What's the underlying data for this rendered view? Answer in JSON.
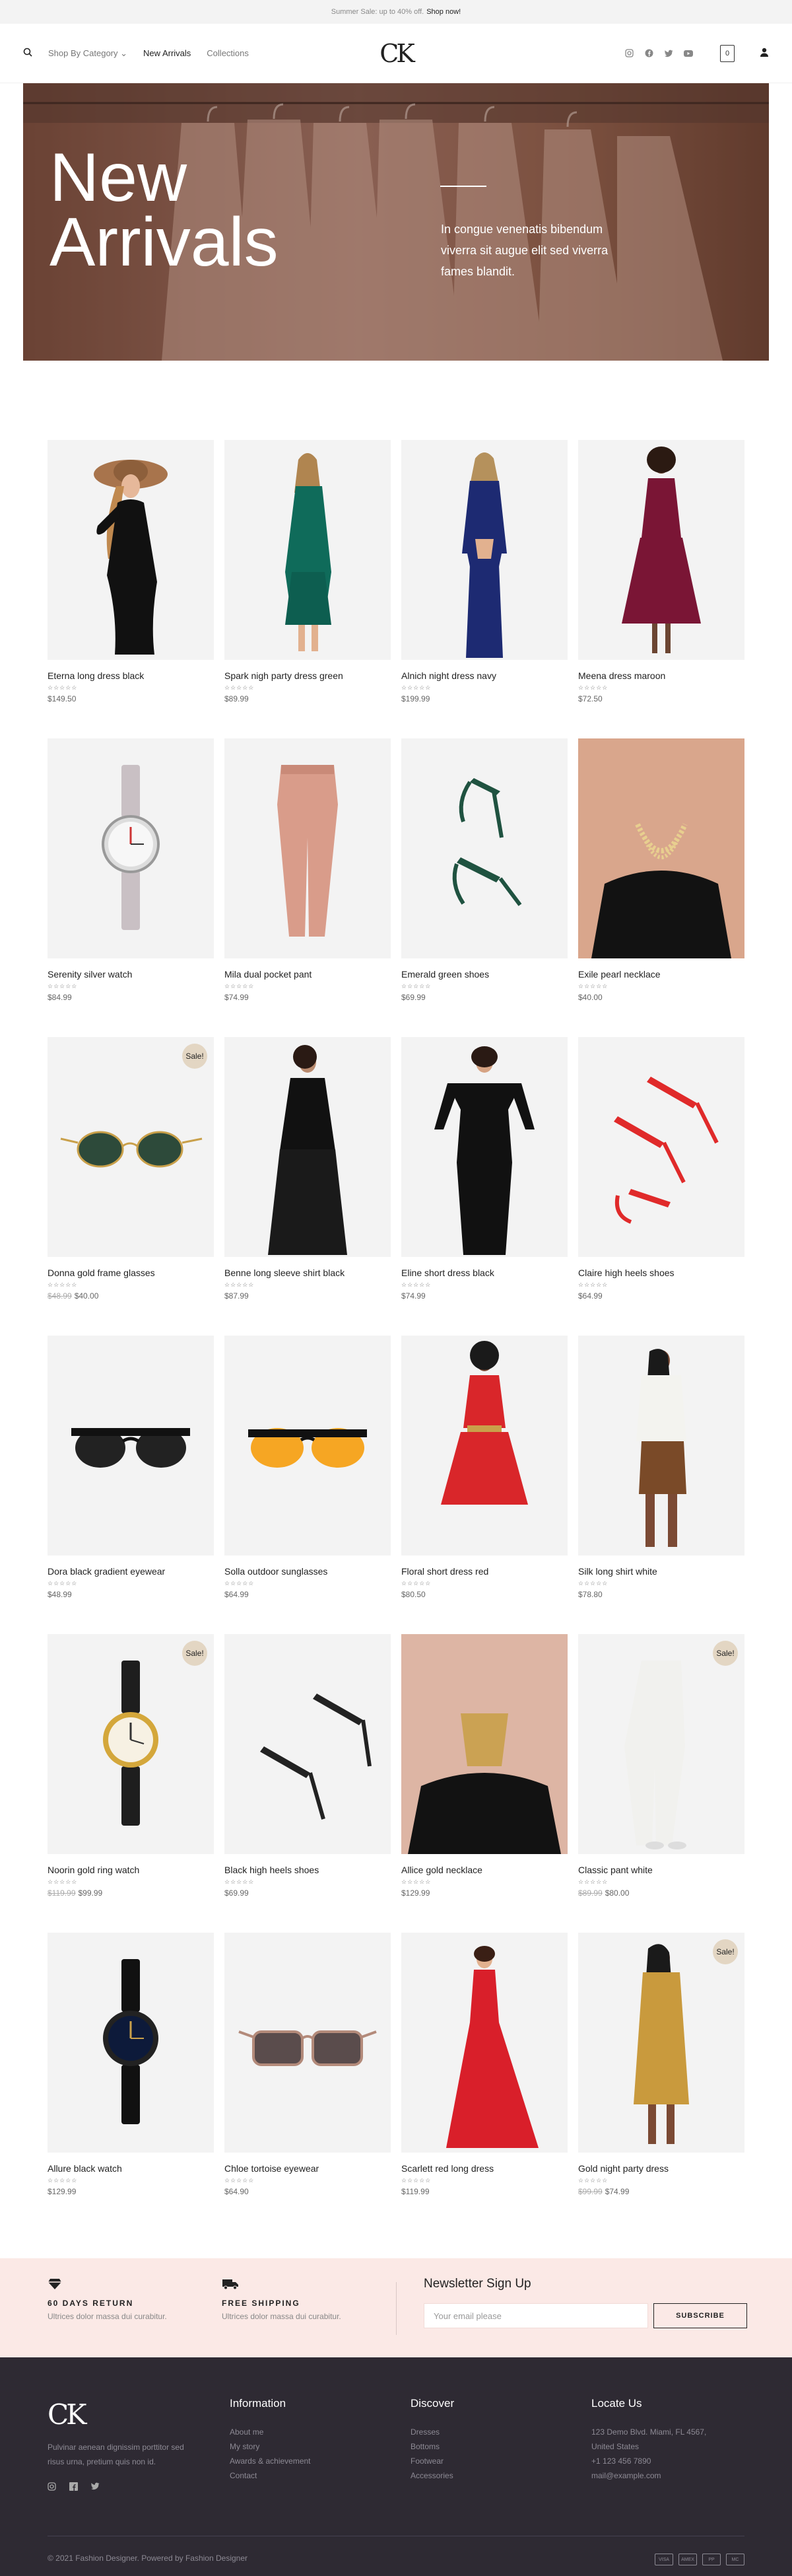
{
  "topbar": {
    "text": "Summer Sale: up to 40% off.",
    "link": "Shop now!"
  },
  "header": {
    "logo": "CK",
    "nav": [
      {
        "label": "Shop By Category",
        "caret": "⌄"
      },
      {
        "label": "New Arrivals"
      },
      {
        "label": "Collections"
      }
    ],
    "cart_count": "0",
    "social": [
      "instagram-icon",
      "facebook-icon",
      "twitter-icon",
      "youtube-icon"
    ]
  },
  "hero": {
    "title": "New\nArrivals",
    "text": "In congue venenatis bibendum viverra sit augue elit sed viverra fames blandit."
  },
  "products": [
    {
      "name": "Eterna long dress black",
      "price": "$149.50",
      "old": "",
      "sale": false
    },
    {
      "name": "Spark nigh party dress green",
      "price": "$89.99",
      "old": "",
      "sale": false
    },
    {
      "name": "Alnich night dress navy",
      "price": "$199.99",
      "old": "",
      "sale": false
    },
    {
      "name": "Meena dress maroon",
      "price": "$72.50",
      "old": "",
      "sale": false
    },
    {
      "name": "Serenity silver watch",
      "price": "$84.99",
      "old": "",
      "sale": false
    },
    {
      "name": "Mila dual pocket pant",
      "price": "$74.99",
      "old": "",
      "sale": false
    },
    {
      "name": "Emerald green shoes",
      "price": "$69.99",
      "old": "",
      "sale": false
    },
    {
      "name": "Exile pearl necklace",
      "price": "$40.00",
      "old": "",
      "sale": false
    },
    {
      "name": "Donna gold frame glasses",
      "price": "$40.00",
      "old": "$48.99",
      "sale": true
    },
    {
      "name": "Benne long sleeve shirt black",
      "price": "$87.99",
      "old": "",
      "sale": false
    },
    {
      "name": "Eline short dress black",
      "price": "$74.99",
      "old": "",
      "sale": false
    },
    {
      "name": "Claire high heels shoes",
      "price": "$64.99",
      "old": "",
      "sale": false
    },
    {
      "name": "Dora black gradient eyewear",
      "price": "$48.99",
      "old": "",
      "sale": false
    },
    {
      "name": "Solla outdoor sunglasses",
      "price": "$64.99",
      "old": "",
      "sale": false
    },
    {
      "name": "Floral short dress red",
      "price": "$80.50",
      "old": "",
      "sale": false
    },
    {
      "name": "Silk long shirt white",
      "price": "$78.80",
      "old": "",
      "sale": false
    },
    {
      "name": "Noorin gold ring watch",
      "price": "$99.99",
      "old": "$119.99",
      "sale": true
    },
    {
      "name": "Black high heels shoes",
      "price": "$69.99",
      "old": "",
      "sale": false
    },
    {
      "name": "Allice gold necklace",
      "price": "$129.99",
      "old": "",
      "sale": false
    },
    {
      "name": "Classic pant white",
      "price": "$80.00",
      "old": "$89.99",
      "sale": true
    },
    {
      "name": "Allure black watch",
      "price": "$129.99",
      "old": "",
      "sale": false
    },
    {
      "name": "Chloe tortoise eyewear",
      "price": "$64.90",
      "old": "",
      "sale": false
    },
    {
      "name": "Scarlett red long dress",
      "price": "$119.99",
      "old": "",
      "sale": false
    },
    {
      "name": "Gold night party dress",
      "price": "$74.99",
      "old": "$99.99",
      "sale": true
    }
  ],
  "sale_label": "Sale!",
  "stars": "☆☆☆☆☆",
  "features": [
    {
      "icon": "diamond-icon",
      "title": "60 DAYS RETURN",
      "desc": "Ultrices dolor massa dui curabitur."
    },
    {
      "icon": "truck-icon",
      "title": "FREE SHIPPING",
      "desc": "Ultrices dolor massa dui curabitur."
    }
  ],
  "newsletter": {
    "title": "Newsletter Sign Up",
    "placeholder": "Your email please",
    "button": "SUBSCRIBE"
  },
  "footer": {
    "logo": "CK",
    "desc": "Pulvinar aenean dignissim porttitor sed risus urna, pretium quis non id.",
    "columns": [
      {
        "title": "Information",
        "items": [
          "About me",
          "My story",
          "Awards & achievement",
          "Contact"
        ]
      },
      {
        "title": "Discover",
        "items": [
          "Dresses",
          "Bottoms",
          "Footwear",
          "Accessories"
        ]
      },
      {
        "title": "Locate Us",
        "items": [
          "123 Demo Blvd. Miami, FL 4567,",
          "United States",
          "+1 123 456 7890",
          "mail@example.com"
        ]
      }
    ],
    "copyright": "© 2021 Fashion Designer. Powered by Fashion Designer",
    "payments": [
      "VISA",
      "AMEX",
      "PP",
      "MC"
    ]
  },
  "colors": {
    "accent": "#e3d6c3",
    "footer_bg": "#2e2a33",
    "features_bg": "#fbe9e6"
  }
}
